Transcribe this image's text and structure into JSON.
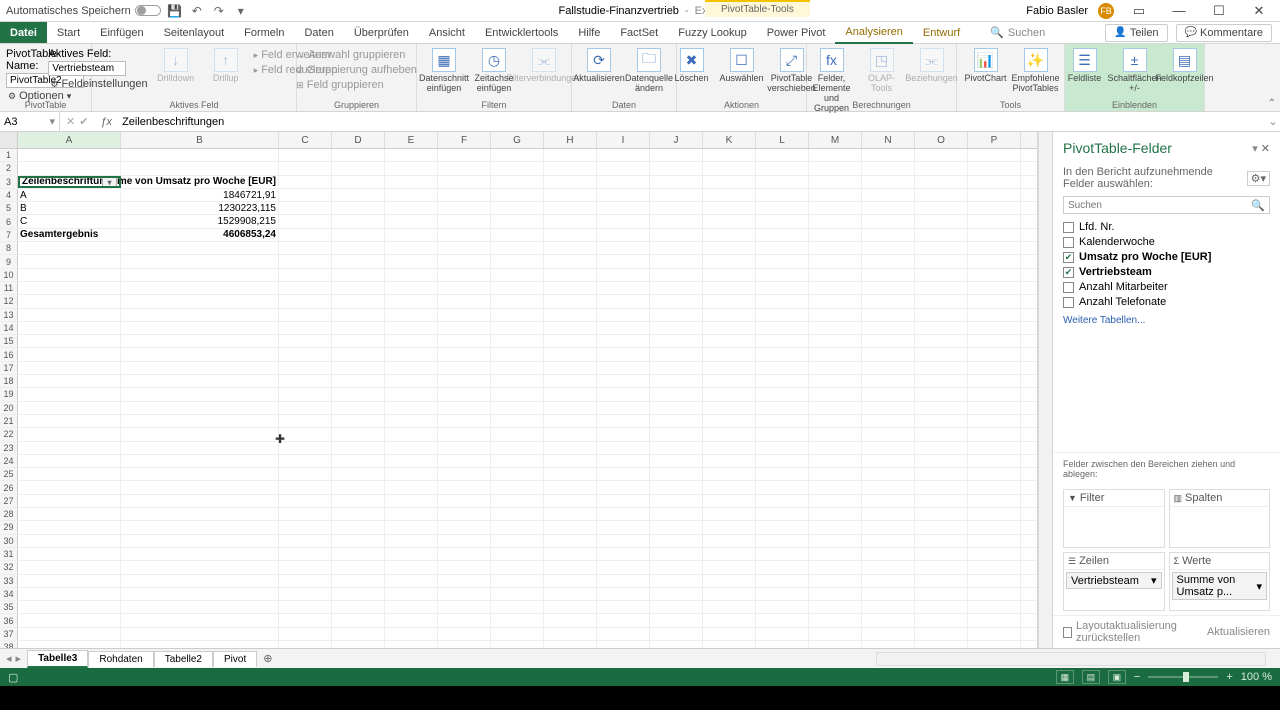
{
  "title": {
    "autosave": "Automatisches Speichern",
    "doc": "Fallstudie-Finanzvertrieb",
    "app": "Excel",
    "ctx": "PivotTable-Tools",
    "user": "Fabio Basler",
    "initials": "FB"
  },
  "tabs": {
    "file": "Datei",
    "start": "Start",
    "einf": "Einfügen",
    "layout": "Seitenlayout",
    "formeln": "Formeln",
    "daten": "Daten",
    "review": "Überprüfen",
    "ansicht": "Ansicht",
    "dev": "Entwicklertools",
    "hilfe": "Hilfe",
    "factset": "FactSet",
    "fuzzy": "Fuzzy Lookup",
    "powerpivot": "Power Pivot",
    "analyze": "Analysieren",
    "design": "Entwurf",
    "search": "Suchen",
    "share": "Teilen",
    "comments": "Kommentare"
  },
  "ribbon": {
    "ptname_lbl": "PivotTable-Name:",
    "ptname_val": "PivotTable2",
    "opt": "Optionen",
    "group1": "PivotTable",
    "activefield_lbl": "Aktives Feld:",
    "activefield_val": "Vertriebsteam",
    "fieldsettings": "Feldeinstellungen",
    "drilldown": "Drilldown",
    "drillup": "Drillup",
    "expand": "Feld erweitern",
    "reduce": "Feld reduzieren",
    "group2": "Aktives Feld",
    "selgrp": "Auswahl gruppieren",
    "ungrp": "Gruppierung aufheben",
    "fgrp": "Feld gruppieren",
    "group3": "Gruppieren",
    "slicer": "Datenschnitt einfügen",
    "timeline": "Zeitachse einfügen",
    "filterconn": "Filterverbindungen",
    "group4": "Filtern",
    "refresh": "Aktualisieren",
    "datasource": "Datenquelle ändern",
    "group5": "Daten",
    "del": "Löschen",
    "sel": "Auswählen",
    "move": "PivotTable verschieben",
    "group6": "Aktionen",
    "calc": "Felder, Elemente und Gruppen",
    "olap": "OLAP-Tools",
    "rel": "Beziehungen",
    "group7": "Berechnungen",
    "chart": "PivotChart",
    "recommend": "Empfohlene PivotTables",
    "group8": "Tools",
    "fieldlist": "Feldliste",
    "buttons": "Schaltflächen +/-",
    "headers": "Feldkopfzeilen",
    "group9": "Einblenden"
  },
  "formula": {
    "name": "A3",
    "val": "Zeilenbeschriftungen"
  },
  "cols": [
    "A",
    "B",
    "C",
    "D",
    "E",
    "F",
    "G",
    "H",
    "I",
    "J",
    "K",
    "L",
    "M",
    "N",
    "O",
    "P"
  ],
  "pivot": {
    "rowlabel_hdr": "Zeilenbeschriftungen",
    "val_hdr": "Summe von Umsatz pro Woche [EUR]",
    "rows": [
      {
        "label": "A",
        "val": "1846721,91"
      },
      {
        "label": "B",
        "val": "1230223,115"
      },
      {
        "label": "C",
        "val": "1529908,215"
      }
    ],
    "total_lbl": "Gesamtergebnis",
    "total_val": "4606853,24"
  },
  "pane": {
    "title": "PivotTable-Felder",
    "sub": "In den Bericht aufzunehmende Felder auswählen:",
    "search_ph": "Suchen",
    "fields": [
      {
        "name": "Lfd. Nr.",
        "checked": false
      },
      {
        "name": "Kalenderwoche",
        "checked": false
      },
      {
        "name": "Umsatz pro Woche [EUR]",
        "checked": true
      },
      {
        "name": "Vertriebsteam",
        "checked": true
      },
      {
        "name": "Anzahl Mitarbeiter",
        "checked": false
      },
      {
        "name": "Anzahl Telefonate",
        "checked": false
      }
    ],
    "more": "Weitere Tabellen...",
    "areas_hint": "Felder zwischen den Bereichen ziehen und ablegen:",
    "filter": "Filter",
    "cols": "Spalten",
    "rows": "Zeilen",
    "vals": "Werte",
    "row_pill": "Vertriebsteam",
    "val_pill": "Summe von Umsatz p...",
    "defer": "Layoutaktualisierung zurückstellen",
    "update": "Aktualisieren"
  },
  "sheets": {
    "t3": "Tabelle3",
    "roh": "Rohdaten",
    "t2": "Tabelle2",
    "pivot": "Pivot"
  },
  "status": {
    "zoom": "100 %"
  }
}
